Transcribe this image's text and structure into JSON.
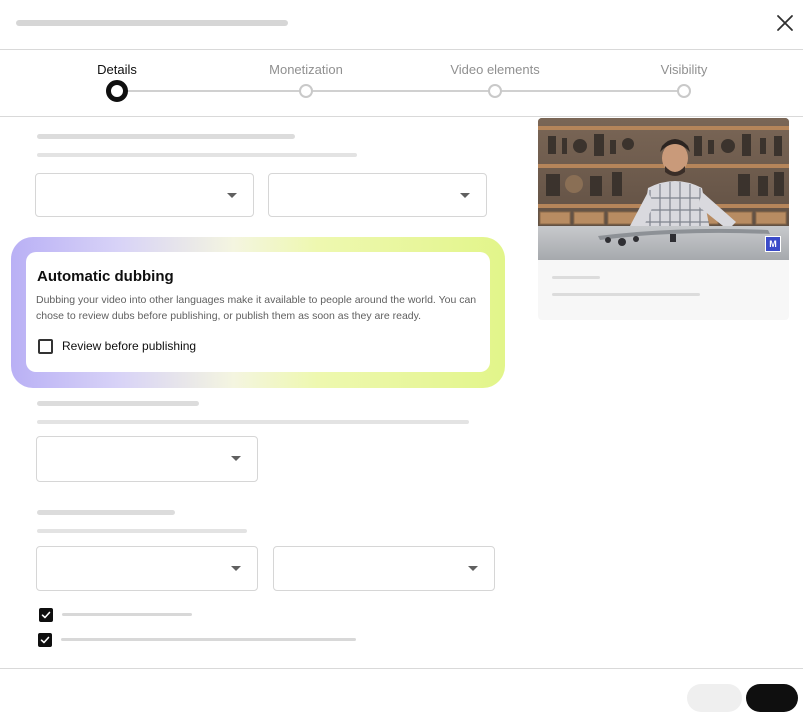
{
  "stepper": {
    "steps": [
      {
        "label": "Details"
      },
      {
        "label": "Monetization"
      },
      {
        "label": "Video elements"
      },
      {
        "label": "Visibility"
      }
    ]
  },
  "dubbing": {
    "title": "Automatic dubbing",
    "description": "Dubbing your video into other languages make it available to people around the world. You can chose to review dubs before publishing, or publish them as soon as they are ready.",
    "review_label": "Review before publishing",
    "review_checked": false
  },
  "thumbnail": {
    "badge": "M"
  },
  "checkboxes": [
    {
      "checked": true
    },
    {
      "checked": true
    }
  ],
  "colors": {
    "primary_button": "#0f0f0f",
    "secondary_button": "#efefef",
    "glow_left": "#b9b0f5",
    "glow_right": "#e2f58a",
    "badge": "#3b4bc9"
  },
  "icons": [
    "close-icon",
    "caret-down-icon",
    "check-icon"
  ]
}
